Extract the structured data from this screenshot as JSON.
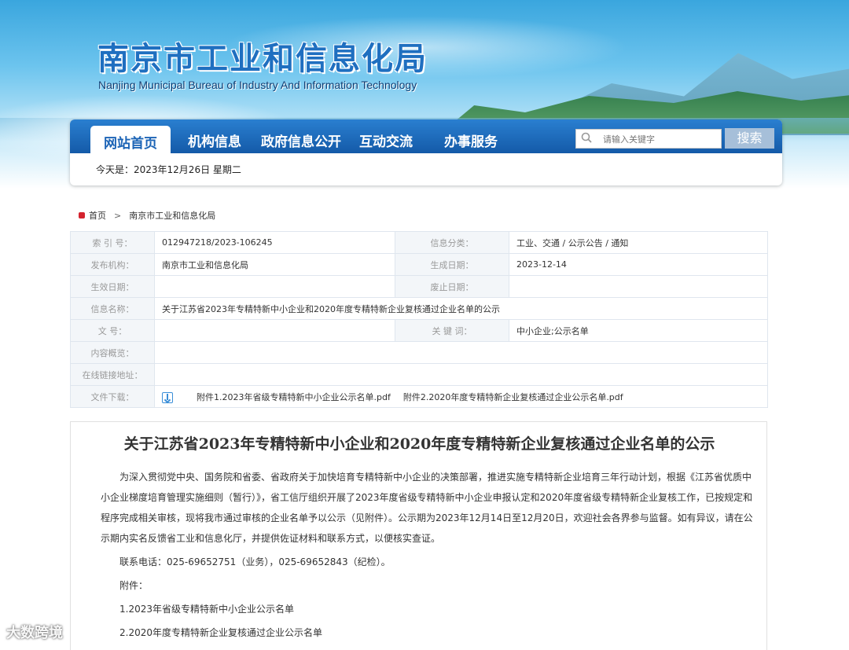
{
  "header": {
    "title": "南京市工业和信息化局",
    "subtitle": "Nanjing Municipal Bureau of Industry And Information Technology"
  },
  "nav": {
    "items": [
      "网站首页",
      "机构信息",
      "政府信息公开",
      "互动交流",
      "办事服务"
    ],
    "active": "网站首页",
    "search_placeholder": "请输入关键字",
    "search_button": "搜索",
    "today": "今天是：2023年12月26日 星期二"
  },
  "breadcrumb": [
    "首页",
    "南京市工业和信息化局"
  ],
  "info": {
    "index_label": "索  引  号：",
    "index_value": "012947218/2023-106245",
    "category_label": "信息分类：",
    "category_value": "工业、交通 / 公示公告 / 通知",
    "publisher_label": "发布机构：",
    "publisher_value": "南京市工业和信息化局",
    "created_label": "生成日期：",
    "created_value": "2023-12-14",
    "effective_label": "生效日期：",
    "effective_value": "",
    "abolished_label": "废止日期：",
    "abolished_value": "",
    "name_label": "信息名称：",
    "name_value": "关于江苏省2023年专精特新中小企业和2020年度专精特新企业复核通过企业名单的公示",
    "docno_label": "文        号：",
    "docno_value": "",
    "keywords_label": "关  键  词：",
    "keywords_value": "中小企业;公示名单",
    "content_label": "内容概览：",
    "content_value": "",
    "link_label": "在线链接地址：",
    "link_value": "",
    "download_label": "文件下载：",
    "attachments": [
      "附件1.2023年省级专精特新中小企业公示名单.pdf",
      "附件2.2020年度专精特新企业复核通过企业公示名单.pdf"
    ]
  },
  "article": {
    "title": "关于江苏省2023年专精特新中小企业和2020年度专精特新企业复核通过企业名单的公示",
    "paragraph1": "为深入贯彻党中央、国务院和省委、省政府关于加快培育专精特新中小企业的决策部署，推进实施专精特新企业培育三年行动计划，根据《江苏省优质中小企业梯度培育管理实施细则（暂行）》，省工信厅组织开展了2023年度省级专精特新中小企业申报认定和2020年度省级专精特新企业复核工作，已按规定和程序完成相关审核，现将我市通过审核的企业名单予以公示（见附件）。公示期为2023年12月14日至12月20日，欢迎社会各界参与监督。如有异议，请在公示期内实名反馈省工业和信息化厅，并提供佐证材料和联系方式，以便核实查证。",
    "contact": "联系电话：025-69652751（业务），025-69652843（纪检）。",
    "attachments_heading": "附件：",
    "att1": "1.2023年省级专精特新中小企业公示名单",
    "att2": "2.2020年度专精特新企业复核通过企业公示名单"
  },
  "watermark": "大数跨境"
}
